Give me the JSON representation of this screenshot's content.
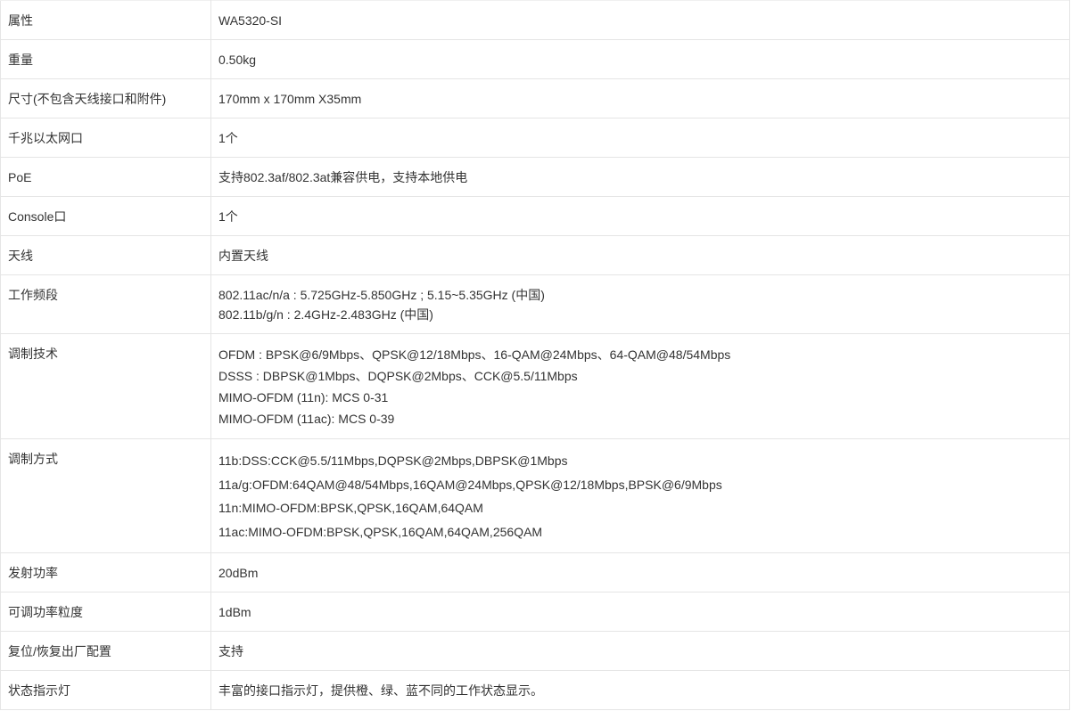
{
  "rows": [
    {
      "label": "属性",
      "values": [
        "WA5320-SI"
      ]
    },
    {
      "label": "重量",
      "values": [
        "0.50kg"
      ]
    },
    {
      "label": "尺寸(不包含天线接口和附件)",
      "values": [
        "170mm x 170mm X35mm"
      ]
    },
    {
      "label": "千兆以太网口",
      "values": [
        "1个"
      ]
    },
    {
      "label": "PoE",
      "values": [
        "支持802.3af/802.3at兼容供电，支持本地供电"
      ]
    },
    {
      "label": "Console口",
      "values": [
        "1个"
      ]
    },
    {
      "label": "天线",
      "values": [
        "内置天线"
      ]
    },
    {
      "label": "工作频段",
      "values": [
        "802.11ac/n/a : 5.725GHz-5.850GHz ; 5.15~5.35GHz (中国)",
        "802.11b/g/n : 2.4GHz-2.483GHz (中国)"
      ]
    },
    {
      "label": "调制技术",
      "values": [
        "OFDM : BPSK@6/9Mbps、QPSK@12/18Mbps、16-QAM@24Mbps、64-QAM@48/54Mbps",
        "DSSS : DBPSK@1Mbps、DQPSK@2Mbps、CCK@5.5/11Mbps",
        "MIMO-OFDM (11n): MCS 0-31",
        "MIMO-OFDM (11ac): MCS 0-39"
      ]
    },
    {
      "label": "调制方式",
      "values": [
        "11b:DSS:CCK@5.5/11Mbps,DQPSK@2Mbps,DBPSK@1Mbps",
        "11a/g:OFDM:64QAM@48/54Mbps,16QAM@24Mbps,QPSK@12/18Mbps,BPSK@6/9Mbps",
        "11n:MIMO-OFDM:BPSK,QPSK,16QAM,64QAM",
        "11ac:MIMO-OFDM:BPSK,QPSK,16QAM,64QAM,256QAM"
      ]
    },
    {
      "label": "发射功率",
      "values": [
        "20dBm"
      ]
    },
    {
      "label": "可调功率粒度",
      "values": [
        "1dBm"
      ]
    },
    {
      "label": "复位/恢复出厂配置",
      "values": [
        "支持"
      ]
    },
    {
      "label": "状态指示灯",
      "values": [
        "丰富的接口指示灯，提供橙、绿、蓝不同的工作状态显示。"
      ]
    }
  ]
}
